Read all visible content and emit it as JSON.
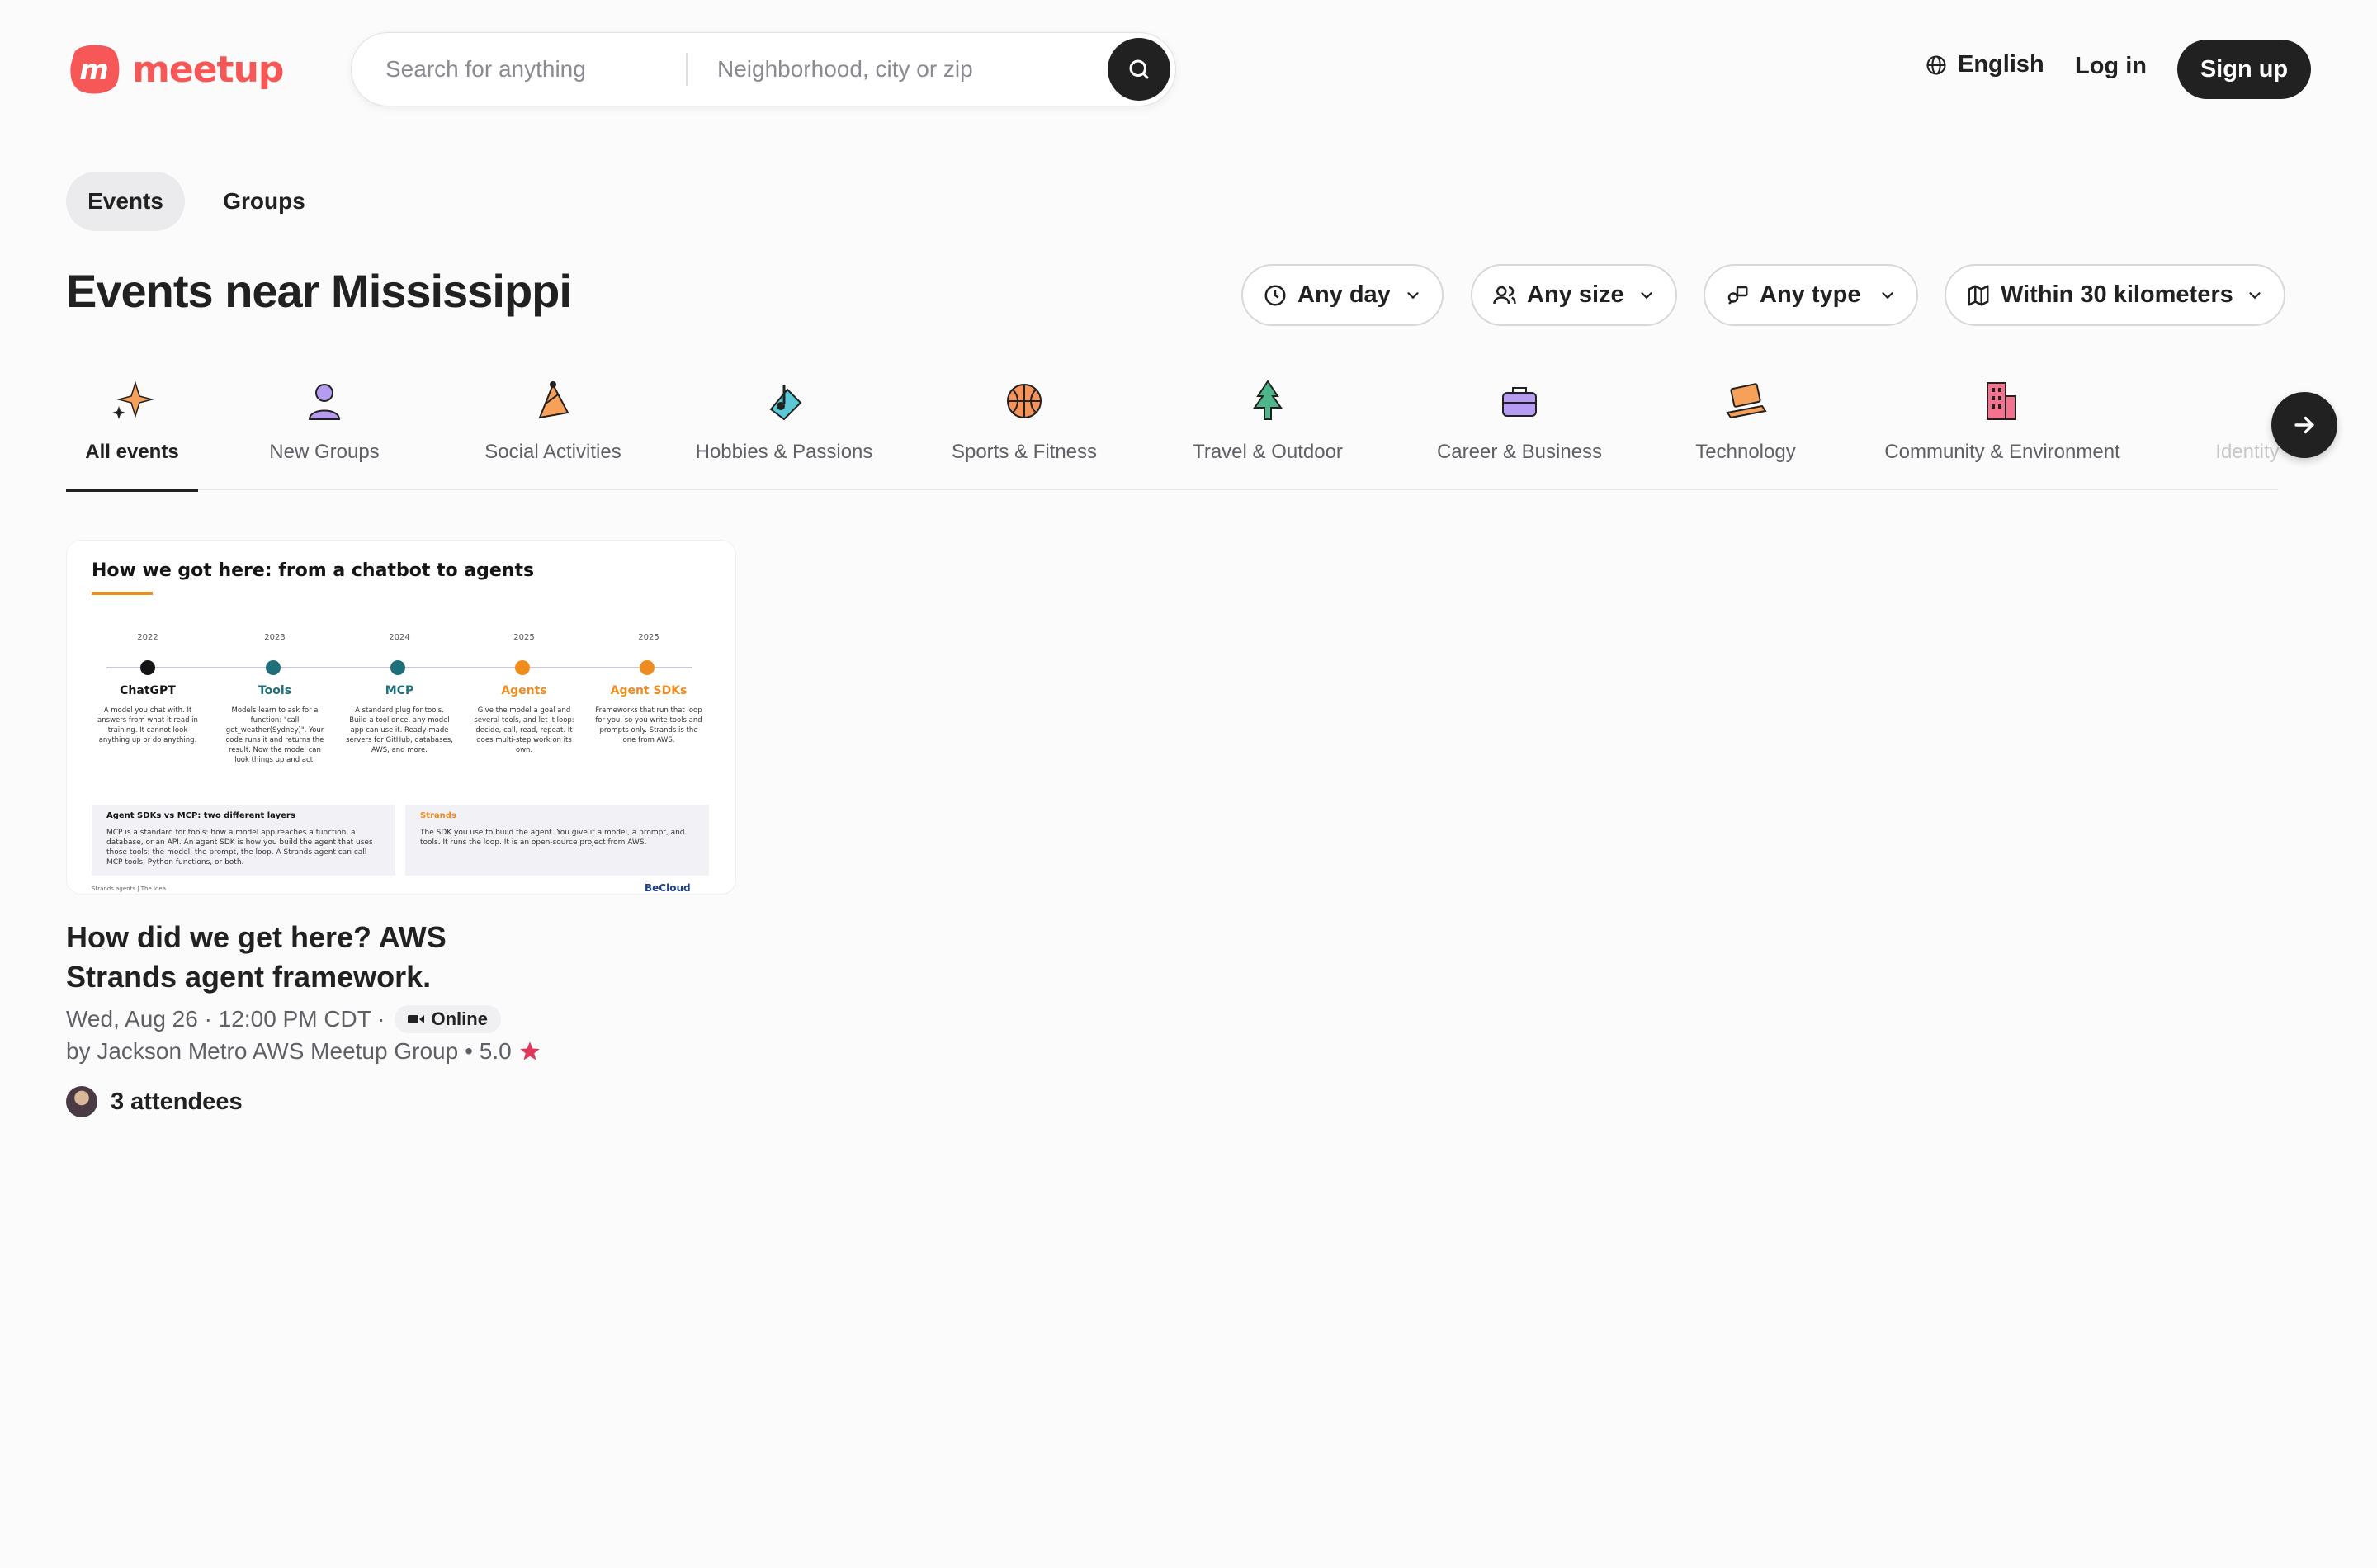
{
  "brand": {
    "name": "meetup",
    "color": "#f65858"
  },
  "search": {
    "what_placeholder": "Search for anything",
    "where_placeholder": "Neighborhood, city or zip"
  },
  "header": {
    "language": "English",
    "login": "Log in",
    "signup": "Sign up"
  },
  "toggle": {
    "events": "Events",
    "groups": "Groups",
    "active": "Events"
  },
  "page_title": "Events near Mississippi",
  "filters": {
    "day": "Any day",
    "size": "Any size",
    "type": "Any type",
    "distance": "Within 30 kilometers"
  },
  "categories": [
    {
      "label": "All events",
      "icon": "sparkles-icon",
      "active": true
    },
    {
      "label": "New Groups",
      "icon": "person-icon"
    },
    {
      "label": "Social Activities",
      "icon": "party-hat-icon"
    },
    {
      "label": "Hobbies & Passions",
      "icon": "music-note-icon"
    },
    {
      "label": "Sports & Fitness",
      "icon": "basketball-icon"
    },
    {
      "label": "Travel & Outdoor",
      "icon": "tree-icon"
    },
    {
      "label": "Career & Business",
      "icon": "briefcase-icon"
    },
    {
      "label": "Technology",
      "icon": "laptop-icon"
    },
    {
      "label": "Community & Environment",
      "icon": "buildings-icon"
    },
    {
      "label": "Identity",
      "icon": "identity-icon"
    }
  ],
  "event": {
    "title": "How did we get here? AWS Strands agent framework.",
    "datetime": "Wed, Aug 26 · 12:00 PM CDT ·",
    "online_label": "Online",
    "group": "by Jackson Metro AWS Meetup Group",
    "rating": "• 5.0",
    "attendees": "3 attendees",
    "thumbnail": {
      "title": "How we got here: from a chatbot to agents",
      "timeline": [
        {
          "year": "2022",
          "name": "ChatGPT",
          "color": "#141414",
          "desc": "A model you chat with. It answers from what it read in training. It cannot look anything up or do anything."
        },
        {
          "year": "2023",
          "name": "Tools",
          "color": "#1f6f7a",
          "desc": "Models learn to ask for a function: \"call get_weather(Sydney)\". Your code runs it and returns the result. Now the model can look things up and act."
        },
        {
          "year": "2024",
          "name": "MCP",
          "color": "#1f6f7a",
          "desc": "A standard plug for tools. Build a tool once, any model app can use it. Ready-made servers for GitHub, databases, AWS, and more."
        },
        {
          "year": "2025",
          "name": "Agents",
          "color": "#f08c1e",
          "desc": "Give the model a goal and several tools, and let it loop: decide, call, read, repeat. It does multi-step work on its own."
        },
        {
          "year": "2025",
          "name": "Agent SDKs",
          "color": "#f08c1e",
          "desc": "Frameworks that run that loop for you, so you write tools and prompts only. Strands is the one from AWS."
        }
      ],
      "box_left_head": "Agent SDKs vs MCP: two different layers",
      "box_left_text": "MCP is a standard for tools: how a model app reaches a function, a database, or an API. An agent SDK is how you build the agent that uses those tools: the model, the prompt, the loop. A Strands agent can call MCP tools, Python functions, or both.",
      "box_right_head": "Strands",
      "box_right_text": "The SDK you use to build the agent. You give it a model, a prompt, and tools. It runs the loop. It is an open-source project from AWS.",
      "footer": "Strands agents | The idea",
      "footer_logo": "BeCloud"
    }
  }
}
